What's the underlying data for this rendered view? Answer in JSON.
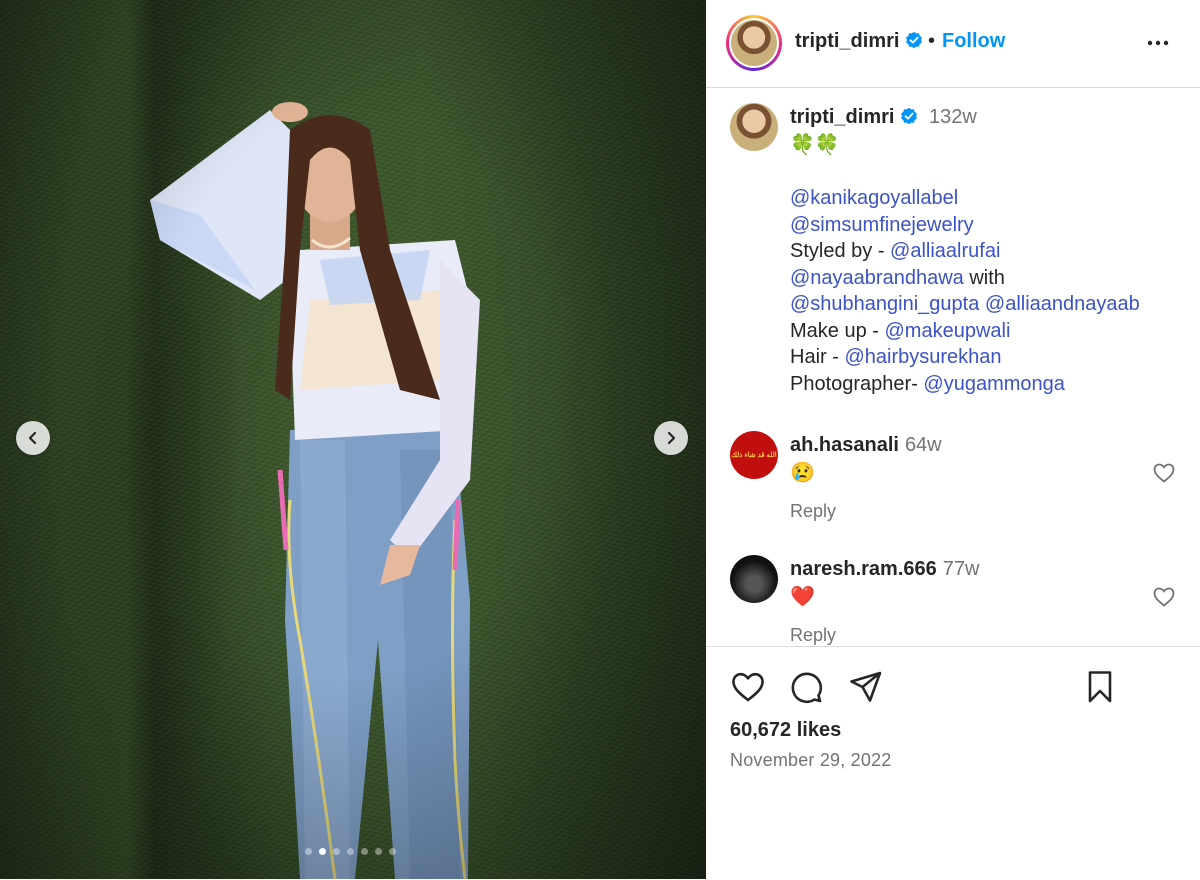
{
  "post": {
    "username": "tripti_dimri",
    "separator": "•",
    "follow_label": "Follow",
    "more_icon": "more-options-icon"
  },
  "carousel": {
    "total_slides": 7,
    "active_slide": 2,
    "prev_icon": "chevron-left-icon",
    "next_icon": "chevron-right-icon"
  },
  "caption": {
    "username": "tripti_dimri",
    "time": "132w",
    "emoji": "🍀🍀",
    "lines": [
      [
        {
          "t": "@kanikagoyallabel",
          "m": true
        }
      ],
      [
        {
          "t": "@simsumfinejewelry",
          "m": true
        }
      ],
      [
        {
          "t": "Styled by - ",
          "m": false
        },
        {
          "t": "@alliaalrufai",
          "m": true
        }
      ],
      [
        {
          "t": "@nayaabrandhawa",
          "m": true
        },
        {
          "t": " with",
          "m": false
        }
      ],
      [
        {
          "t": "@shubhangini_gupta",
          "m": true
        },
        {
          "t": " ",
          "m": false
        },
        {
          "t": "@alliaandnayaab",
          "m": true
        }
      ],
      [
        {
          "t": "Make up - ",
          "m": false
        },
        {
          "t": "@makeupwali",
          "m": true
        }
      ],
      [
        {
          "t": "Hair - ",
          "m": false
        },
        {
          "t": "@hairbysurekhan",
          "m": true
        }
      ],
      [
        {
          "t": "Photographer- ",
          "m": false
        },
        {
          "t": "@yugammonga",
          "m": true
        }
      ]
    ]
  },
  "comments": [
    {
      "username": "ah.hasanali",
      "time": "64w",
      "text": "😢",
      "reply_label": "Reply"
    },
    {
      "username": "naresh.ram.666",
      "time": "77w",
      "text": "❤️",
      "reply_label": "Reply"
    }
  ],
  "stats": {
    "likes": "60,672 likes",
    "date": "November 29, 2022"
  },
  "colors": {
    "accent": "#0095f6",
    "mention": "#3c52c9",
    "verified": "#0095f6"
  }
}
